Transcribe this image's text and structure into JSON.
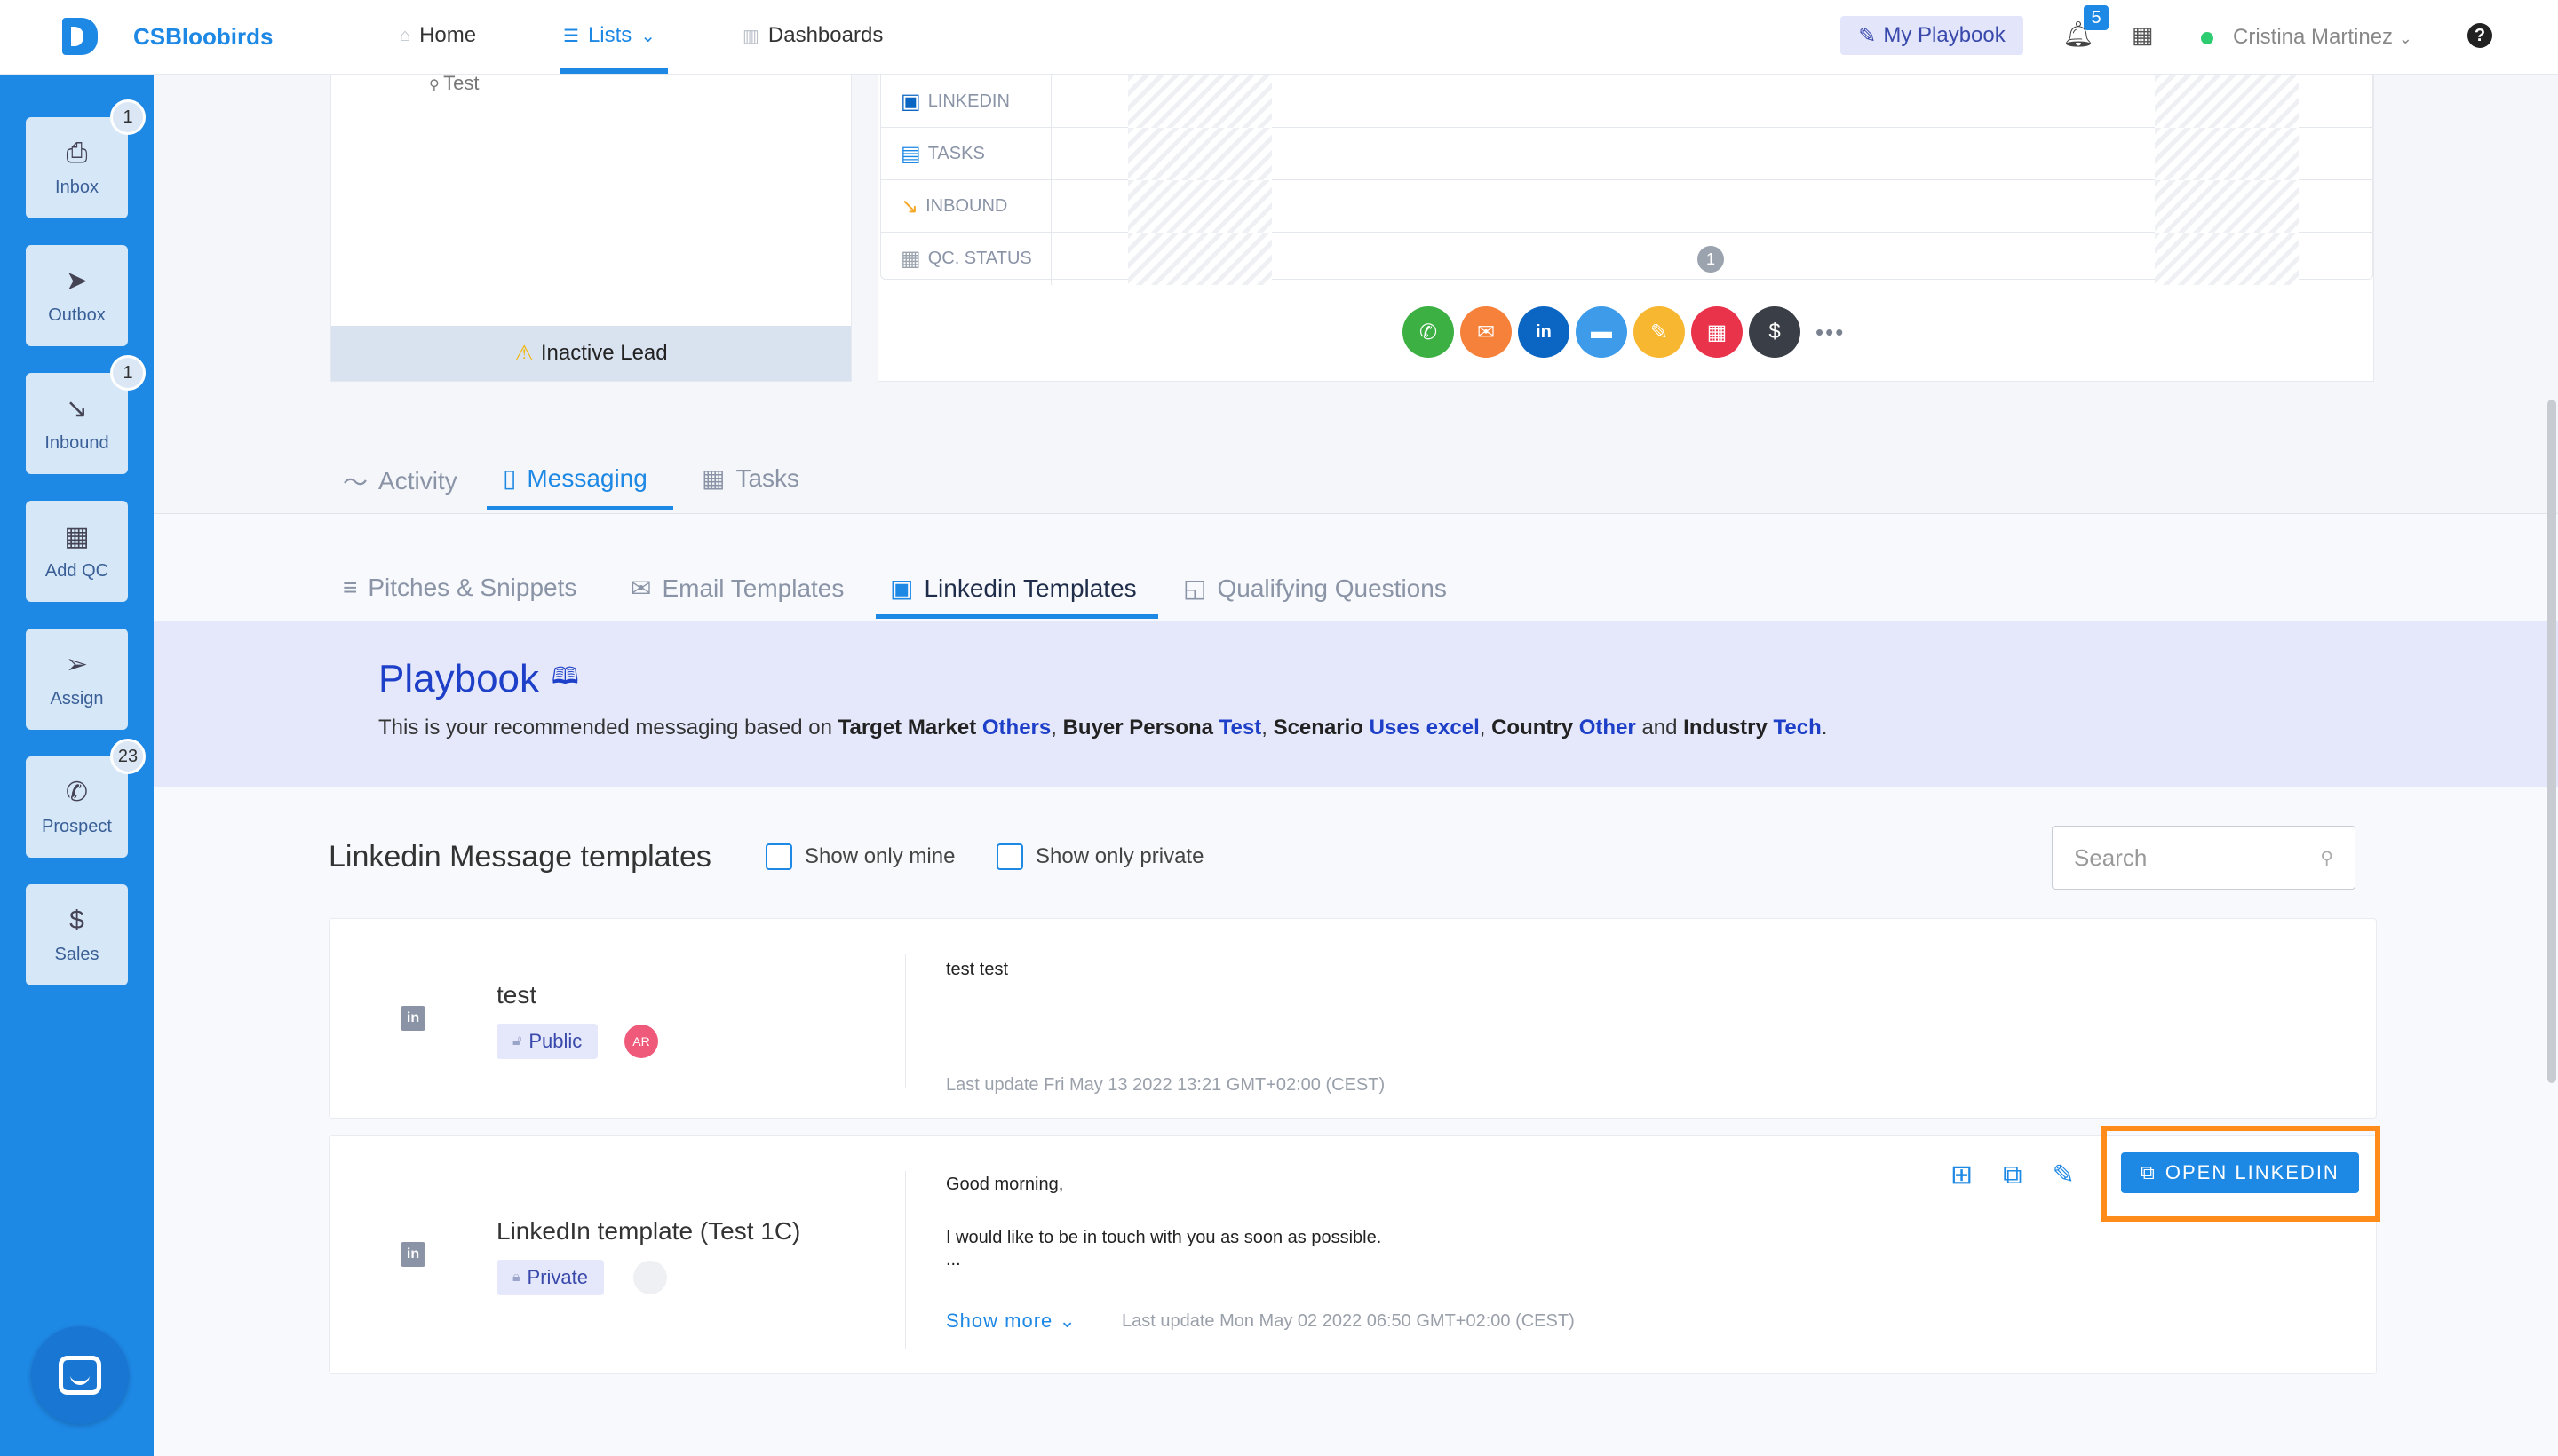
{
  "app": {
    "name": "CSBloobirds"
  },
  "topnav": {
    "home": "Home",
    "lists": "Lists",
    "dashboards": "Dashboards",
    "my_playbook": "My Playbook",
    "notifications": "5",
    "user": "Cristina Martinez"
  },
  "sidebar": {
    "inbox": {
      "label": "Inbox",
      "badge": "1"
    },
    "outbox": {
      "label": "Outbox"
    },
    "inbound": {
      "label": "Inbound",
      "badge": "1"
    },
    "add_qc": {
      "label": "Add QC"
    },
    "assign": {
      "label": "Assign"
    },
    "prospect": {
      "label": "Prospect",
      "badge": "23"
    },
    "sales": {
      "label": "Sales"
    }
  },
  "lead": {
    "test_label": "Test",
    "status": "Inactive Lead"
  },
  "activity_rows": {
    "linkedin": "LINKEDIN",
    "tasks": "TASKS",
    "inbound": "INBOUND",
    "qc_status": "QC. STATUS",
    "qc_count": "1"
  },
  "tabs": {
    "activity": "Activity",
    "messaging": "Messaging",
    "tasks": "Tasks"
  },
  "subtabs": {
    "pitches": "Pitches & Snippets",
    "email": "Email Templates",
    "linkedin": "Linkedin Templates",
    "qualifying": "Qualifying Questions"
  },
  "playbook": {
    "title": "Playbook",
    "intro": "This is your recommended messaging based on ",
    "target_market_label": "Target Market",
    "target_market_value": "Others",
    "buyer_persona_label": "Buyer Persona",
    "buyer_persona_value": "Test",
    "scenario_label": "Scenario",
    "scenario_value": "Uses excel",
    "country_label": "Country",
    "country_value": "Other",
    "and_text": "and",
    "industry_label": "Industry",
    "industry_value": "Tech"
  },
  "templates": {
    "title": "Linkedin Message templates",
    "show_only_mine": "Show only mine",
    "show_only_private": "Show only private",
    "search_placeholder": "Search",
    "items": [
      {
        "name": "test",
        "visibility": "Public",
        "avatar": "AR",
        "body_lines": [
          "test test"
        ],
        "updated": "Last update Fri May 13 2022 13:21 GMT+02:00 (CEST)"
      },
      {
        "name": "LinkedIn template (Test 1C)",
        "visibility": "Private",
        "body_lines": [
          "Good morning,",
          "I would like to be in touch with you as soon as possible.",
          "..."
        ],
        "show_more": "Show more",
        "updated": "Last update Mon May 02 2022 06:50 GMT+02:00 (CEST)",
        "open_button": "OPEN LINKEDIN"
      }
    ]
  },
  "colors": {
    "brand": "#1e88e5",
    "highlight": "#ff8c1a",
    "playbook_banner": "#e5e8fb"
  }
}
